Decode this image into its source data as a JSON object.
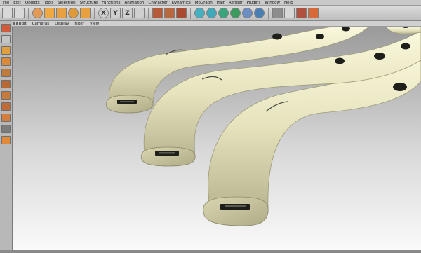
{
  "menu": {
    "items": [
      "File",
      "Edit",
      "Objects",
      "Tools",
      "Selection",
      "Structure",
      "Functions",
      "Animation",
      "Character",
      "Dynamics",
      "MoGraph",
      "Hair",
      "Render",
      "Plugins",
      "Window",
      "Help"
    ]
  },
  "toolbar": {
    "buttons": [
      {
        "name": "undo-icon",
        "color": "#d8d8d8"
      },
      {
        "name": "redo-icon",
        "color": "#d8d8d8"
      },
      {
        "name": "live-selection-icon",
        "color": "#e39a54"
      },
      {
        "name": "move-icon",
        "color": "#f0a842"
      },
      {
        "name": "scale-icon",
        "color": "#e8a040"
      },
      {
        "name": "rotate-icon",
        "color": "#e09a3a"
      },
      {
        "name": "recent-tools-icon",
        "color": "#e8a040"
      },
      {
        "name": "x-axis-icon",
        "color": "#cfcfcf",
        "label": "X"
      },
      {
        "name": "y-axis-icon",
        "color": "#cfcfcf",
        "label": "Y"
      },
      {
        "name": "z-axis-icon",
        "color": "#cfcfcf",
        "label": "Z"
      },
      {
        "name": "world-coords-icon",
        "color": "#cfcfcf"
      },
      {
        "name": "render-view-icon",
        "color": "#b55a3a"
      },
      {
        "name": "render-picture-icon",
        "color": "#b8683d"
      },
      {
        "name": "render-settings-icon",
        "color": "#a84b30"
      },
      {
        "name": "cube-icon",
        "color": "#45b0c2"
      },
      {
        "name": "spline-pen-icon",
        "color": "#3fa8ba"
      },
      {
        "name": "subdivision-icon",
        "color": "#3aa47a"
      },
      {
        "name": "array-icon",
        "color": "#3b9b5e"
      },
      {
        "name": "deformer-icon",
        "color": "#6b8fc2"
      },
      {
        "name": "environment-icon",
        "color": "#4a7fb5"
      },
      {
        "name": "camera-icon",
        "color": "#8d8d8d"
      },
      {
        "name": "light-icon",
        "color": "#d8d8d8"
      },
      {
        "name": "tag-icon",
        "color": "#b05040"
      },
      {
        "name": "layout-icon",
        "color": "#d86a3a"
      }
    ]
  },
  "viewport_menu": {
    "items": [
      "Edit",
      "Cameras",
      "Display",
      "Filter",
      "View"
    ]
  },
  "sidebar": {
    "buttons": [
      {
        "name": "make-editable-icon",
        "color": "#d25b3a"
      },
      {
        "name": "snap-icon",
        "color": "#c4c4c4"
      },
      {
        "name": "model-mode-icon",
        "color": "#e0a040"
      },
      {
        "name": "object-axis-icon",
        "color": "#d98a3a"
      },
      {
        "name": "points-mode-icon",
        "color": "#c27a3a"
      },
      {
        "name": "edges-mode-icon",
        "color": "#b86a34"
      },
      {
        "name": "polygons-mode-icon",
        "color": "#c87a3c"
      },
      {
        "name": "texture-mode-icon",
        "color": "#c06c38"
      },
      {
        "name": "workplane-icon",
        "color": "#d27e3e"
      },
      {
        "name": "checker-icon",
        "color": "#7c7c7c"
      },
      {
        "name": "solo-icon",
        "color": "#e08a3a"
      }
    ]
  },
  "scene": {
    "background_top": "#9a9a9a",
    "background_bottom": "#fafafa",
    "tube_color": "#e9e6c2",
    "tube_shadow": "#a9a784",
    "hole_color": "#1e1e1a"
  }
}
